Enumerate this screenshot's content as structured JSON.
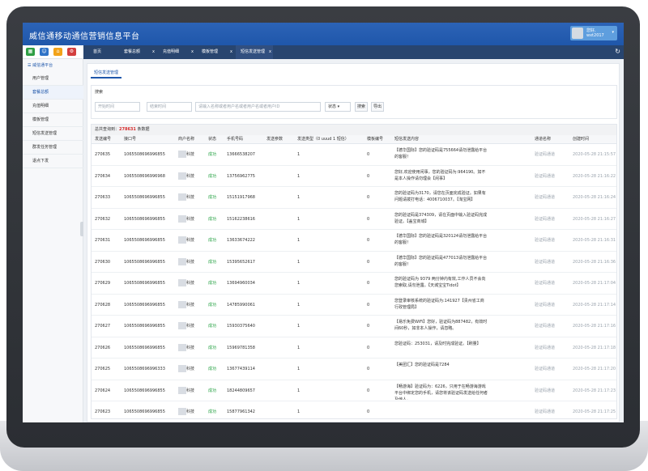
{
  "app": {
    "title": "威信通移动通信营销信息平台",
    "user": {
      "name": "您好,",
      "id": "wxt2017"
    }
  },
  "tabs": [
    {
      "label": "首页"
    },
    {
      "label": "套餐总额"
    },
    {
      "label": "充值明细"
    },
    {
      "label": "模板管理"
    },
    {
      "label": "短信发送管理"
    }
  ],
  "sidebar": {
    "group": "威信通平台",
    "items": [
      {
        "label": "用户管理"
      },
      {
        "label": "套餐总额"
      },
      {
        "label": "充值明细"
      },
      {
        "label": "模板管理"
      },
      {
        "label": "短信发送管理"
      },
      {
        "label": "群发任务管理"
      },
      {
        "label": "退点下发"
      }
    ]
  },
  "page": {
    "subtab": "短信发送管理",
    "search": {
      "title": "搜索",
      "start_placeholder": "开始时间",
      "end_placeholder": "结束时间",
      "keyword_placeholder": "请输入名称或者用户名或者用户名或者用户ID",
      "status_value": "状态",
      "search_btn": "搜索",
      "export_btn": "导出"
    },
    "summary": {
      "prefix": "总共查询到：",
      "count": "278631",
      "suffix": " 条数据"
    }
  },
  "table": {
    "headers": [
      "发送编号",
      "接口号",
      "商户名称",
      "状态",
      "手机号码",
      "发送参数",
      "发送类型（0 uuud 1 短信）",
      "模板编号",
      "短信发送内容",
      "通道名称",
      "创建时间"
    ],
    "rows": [
      {
        "id": "270635",
        "port": "1065508696996855",
        "merchant": "科技",
        "status": "成功",
        "phone": "13666538207",
        "type": "1",
        "tpl": "0",
        "content": "【德华国际】您的验证码是755664请勿泄露给平台的客服！",
        "channel": "验证码通道",
        "time": "2020-05-28 21:15:57"
      },
      {
        "id": "270634",
        "port": "1065508696996968",
        "merchant": "科技",
        "status": "成功",
        "phone": "13756962775",
        "type": "1",
        "tpl": "0",
        "content": "您好,欢迎使用闲事，您的验证码为:964190。如不是本人操作请勿理会【闲事】",
        "channel": "验证码通道",
        "time": "2020-05-28 21:16:22"
      },
      {
        "id": "270633",
        "port": "1065508696996855",
        "merchant": "科技",
        "status": "成功",
        "phone": "15151917968",
        "type": "1",
        "tpl": "0",
        "content": "您的验证码为3170，请您在页面完成验证。如果有问题请拨打电话：4006710037。【淘宝网】",
        "channel": "验证码通道",
        "time": "2020-05-28 21:16:24"
      },
      {
        "id": "270632",
        "port": "1065508696996855",
        "merchant": "科技",
        "status": "成功",
        "phone": "15162238616",
        "type": "1",
        "tpl": "0",
        "content": "您的验证码是374309，请在页面中输入验证码完成验证。【盖宝商城】",
        "channel": "验证码通道",
        "time": "2020-05-28 21:16:27"
      },
      {
        "id": "270631",
        "port": "1065508696996855",
        "merchant": "科技",
        "status": "成功",
        "phone": "13633674222",
        "type": "1",
        "tpl": "0",
        "content": "【德华国际】您的验证码是320124请勿泄露给平台的客服！",
        "channel": "验证码通道",
        "time": "2020-05-28 21:16:31"
      },
      {
        "id": "270630",
        "port": "1065508696996855",
        "merchant": "科技",
        "status": "成功",
        "phone": "15395652617",
        "type": "1",
        "tpl": "0",
        "content": "【德华国际】您的验证码是477013请勿泄露给平台的客服！",
        "channel": "验证码通道",
        "time": "2020-05-28 21:16:36"
      },
      {
        "id": "270629",
        "port": "1065508696996855",
        "merchant": "科技",
        "status": "成功",
        "phone": "13694960034",
        "type": "1",
        "tpl": "0",
        "content": "您的验证码为 9379 两分钟内有效,工作人员不会向您索取,请勿泄露。【天城宝宝Tidot】",
        "channel": "验证码通道",
        "time": "2020-05-28 21:17:04"
      },
      {
        "id": "270628",
        "port": "1065508696996855",
        "merchant": "科技",
        "status": "成功",
        "phone": "14785990061",
        "type": "1",
        "tpl": "0",
        "content": "您登录审核系统的验证码为:141927【贵州省工商行政管理局】",
        "channel": "验证码通道",
        "time": "2020-05-28 21:17:14"
      },
      {
        "id": "270627",
        "port": "1065508696996855",
        "merchant": "科技",
        "status": "成功",
        "phone": "15930375640",
        "type": "1",
        "tpl": "0",
        "content": "【易乐免费WiFi】您好，验证码为887482，有效时间60秒，如非本人操作，请忽略。",
        "channel": "验证码通道",
        "time": "2020-05-28 21:17:16"
      },
      {
        "id": "270626",
        "port": "1065508696996855",
        "merchant": "科技",
        "status": "成功",
        "phone": "15969781358",
        "type": "1",
        "tpl": "0",
        "content": "您验证码：253031，请及时完成验证。【刷量】",
        "channel": "验证码通道",
        "time": "2020-05-28 21:17:18"
      },
      {
        "id": "270625",
        "port": "1065508696996333",
        "merchant": "科技",
        "status": "成功",
        "phone": "13677439114",
        "type": "1",
        "tpl": "0",
        "content": "【美团汇】您的验证码是7284",
        "channel": "验证码通道",
        "time": "2020-05-28 21:17:20"
      },
      {
        "id": "270624",
        "port": "1065508696996855",
        "merchant": "科技",
        "status": "成功",
        "phone": "18244809657",
        "type": "1",
        "tpl": "0",
        "content": "【畅游海】验证码为：6226，只用于在畅游海游戏平台中绑定您的手机，请您将该验证码发送给任何者及他人。",
        "channel": "验证码通道",
        "time": "2020-05-28 21:17:23"
      },
      {
        "id": "270623",
        "port": "1065508696996855",
        "merchant": "科技",
        "status": "成功",
        "phone": "15877961342",
        "type": "1",
        "tpl": "0",
        "content": "",
        "channel": "验证码通道",
        "time": "2020-05-28 21:17:25"
      }
    ]
  },
  "colors": {
    "brand": "#1f57aa",
    "success": "#23a041",
    "count": "#d62828"
  }
}
